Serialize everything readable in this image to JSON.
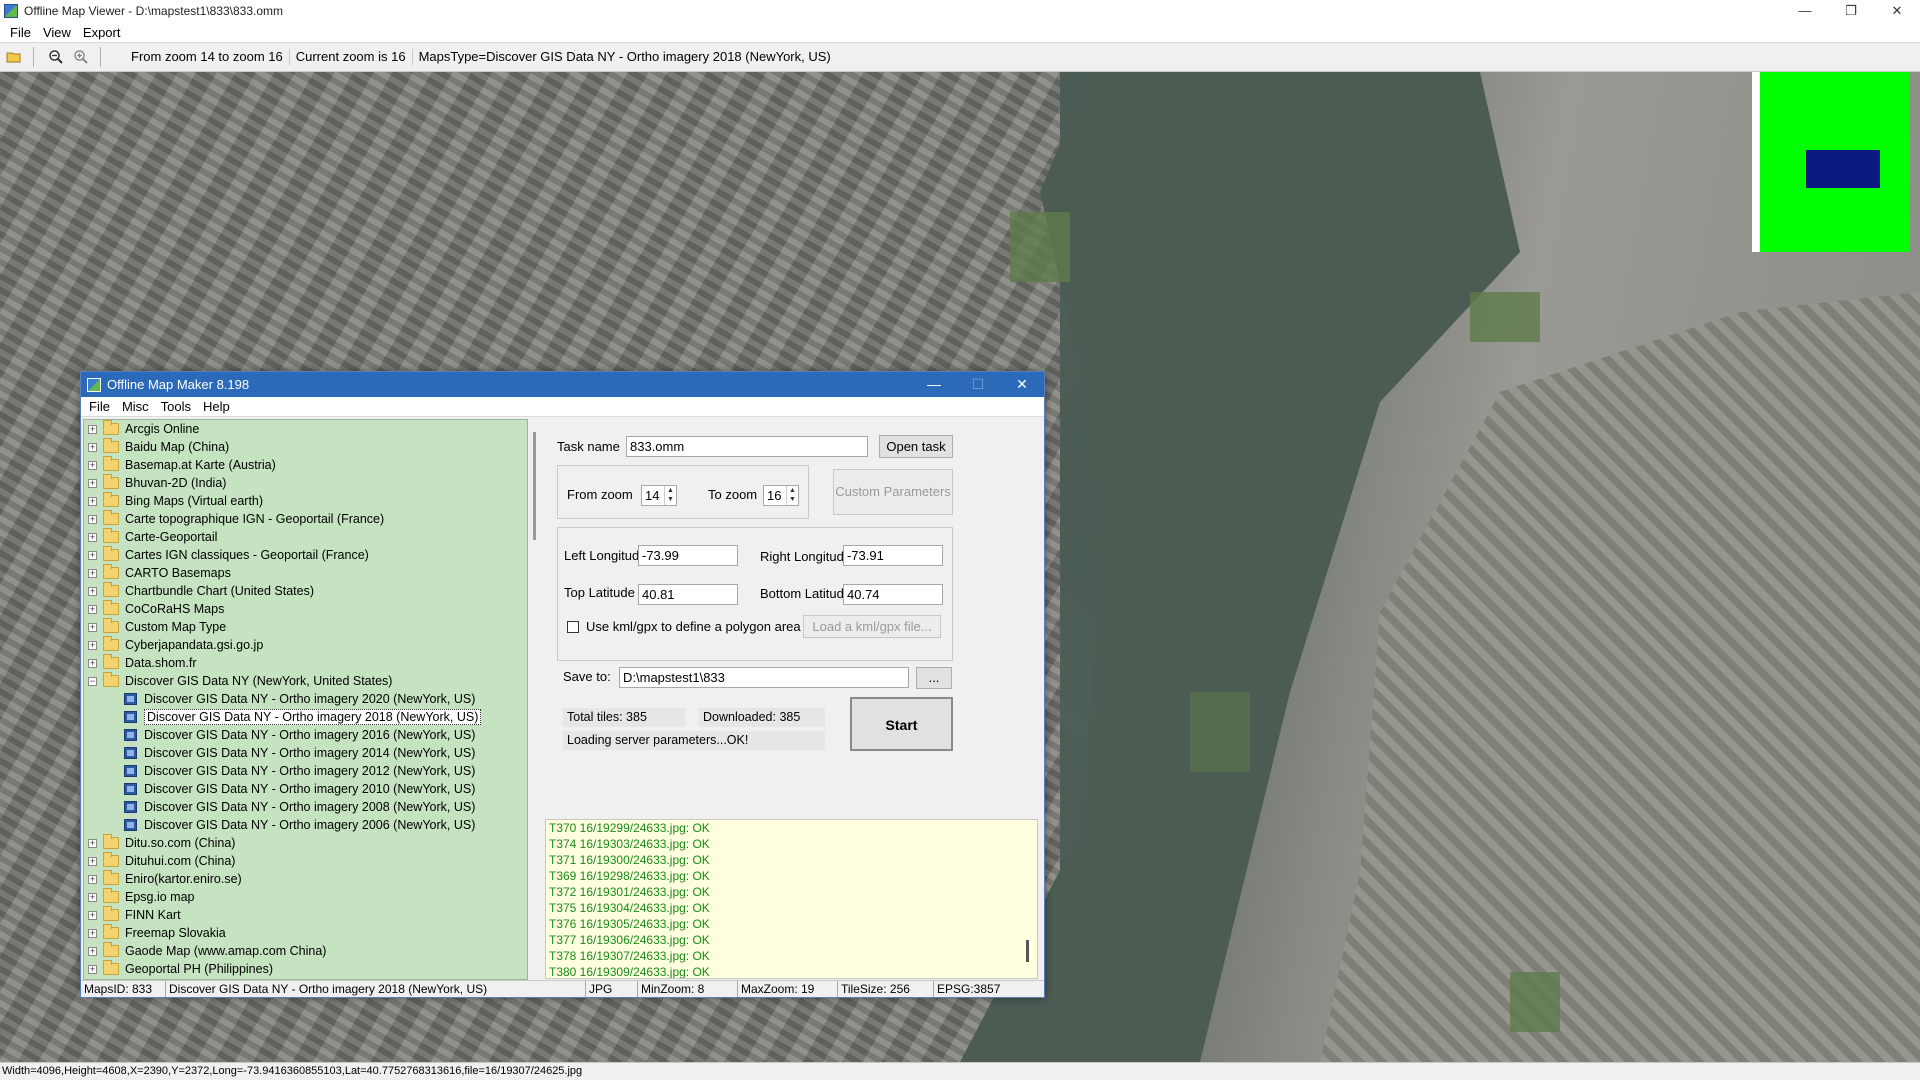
{
  "viewer": {
    "title": "Offline Map Viewer - D:\\mapstest1\\833\\833.omm",
    "window_controls": {
      "minimize": "—",
      "restore": "❐",
      "close": "✕"
    },
    "menu": [
      "File",
      "View",
      "Export"
    ],
    "toolbar": {
      "zoom_range": "From zoom 14 to zoom 16",
      "current_zoom": "Current zoom is 16",
      "maps_type": "MapsType=Discover GIS Data NY - Ortho imagery 2018 (NewYork, US)"
    },
    "minimap": {
      "background_color": "#00ff00",
      "viewport_color": "#0a1a80"
    },
    "status": "Width=4096,Height=4608,X=2390,Y=2372,Long=-73.9416360855103,Lat=40.7752768313616,file=16/19307/24625.jpg"
  },
  "dialog": {
    "title": "Offline Map Maker 8.198",
    "window_controls": {
      "minimize": "—",
      "maximize": "☐",
      "close": "✕"
    },
    "menu": [
      "File",
      "Misc",
      "Tools",
      "Help"
    ],
    "tree": {
      "providers_before": [
        "Arcgis Online",
        "Baidu Map (China)",
        "Basemap.at Karte (Austria)",
        "Bhuvan-2D (India)",
        "Bing Maps (Virtual earth)",
        "Carte topographique IGN - Geoportail (France)",
        "Carte-Geoportail",
        "Cartes IGN classiques - Geoportail (France)",
        "CARTO Basemaps",
        "Chartbundle Chart (United States)",
        "CoCoRaHS Maps",
        "Custom Map Type",
        "Cyberjapandata.gsi.go.jp",
        "Data.shom.fr"
      ],
      "expanded": {
        "label": "Discover GIS Data NY (NewYork, United States)",
        "children": [
          "Discover GIS Data NY - Ortho imagery 2020 (NewYork, US)",
          "Discover GIS Data NY - Ortho imagery 2018 (NewYork, US)",
          "Discover GIS Data NY - Ortho imagery 2016 (NewYork, US)",
          "Discover GIS Data NY - Ortho imagery 2014 (NewYork, US)",
          "Discover GIS Data NY - Ortho imagery 2012 (NewYork, US)",
          "Discover GIS Data NY - Ortho imagery 2010 (NewYork, US)",
          "Discover GIS Data NY - Ortho imagery 2008 (NewYork, US)",
          "Discover GIS Data NY - Ortho imagery 2006 (NewYork, US)"
        ],
        "selected_index": 1
      },
      "providers_after": [
        "Ditu.so.com (China)",
        "Dituhui.com (China)",
        "Eniro(kartor.eniro.se)",
        "Epsg.io map",
        "FINN Kart",
        "Freemap Slovakia",
        "Gaode Map (www.amap.com China)",
        "Geoportal PH (Philippines)"
      ]
    },
    "task": {
      "name_label": "Task name",
      "name_value": "833.omm",
      "open_button": "Open task ...",
      "from_zoom_label": "From zoom",
      "from_zoom_value": "14",
      "to_zoom_label": "To zoom",
      "to_zoom_value": "16",
      "custom_params_button": "Custom Parameters",
      "left_lon_label": "Left Longitude",
      "left_lon_value": "-73.99",
      "right_lon_label": "Right Longitude",
      "right_lon_value": "-73.91",
      "top_lat_label": "Top Latitude",
      "top_lat_value": "40.81",
      "bottom_lat_label": "Bottom Latitude",
      "bottom_lat_value": "40.74",
      "kml_checkbox_label": "Use kml/gpx to define a polygon area",
      "kml_checked": false,
      "load_kml_button": "Load a kml/gpx file...",
      "save_to_label": "Save to:",
      "save_to_value": "D:\\mapstest1\\833",
      "browse_button": "...",
      "total_tiles": "Total tiles: 385",
      "downloaded": "Downloaded: 385",
      "status_message": "Loading server parameters...OK!",
      "start_button": "Start"
    },
    "log": [
      "T370 16/19299/24633.jpg: OK",
      "T374 16/19303/24633.jpg: OK",
      "T371 16/19300/24633.jpg: OK",
      "T369 16/19298/24633.jpg: OK",
      "T372 16/19301/24633.jpg: OK",
      "T375 16/19304/24633.jpg: OK",
      "T376 16/19305/24633.jpg: OK",
      "T377 16/19306/24633.jpg: OK",
      "T378 16/19307/24633.jpg: OK",
      "T380 16/19309/24633.jpg: OK"
    ],
    "status": {
      "maps_id": "MapsID: 833",
      "map_name": "Discover GIS Data NY - Ortho imagery 2018 (NewYork, US)",
      "format": "JPG",
      "min_zoom": "MinZoom: 8",
      "max_zoom": "MaxZoom: 19",
      "tile_size": "TileSize: 256",
      "epsg": "EPSG:3857"
    }
  }
}
